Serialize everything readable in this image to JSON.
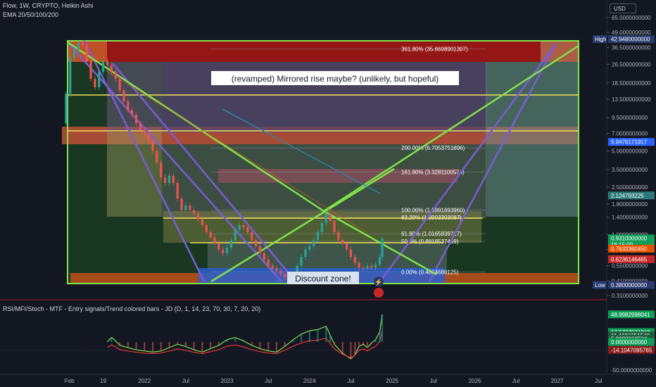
{
  "header": {
    "symbol_line": "Flow, 1W, CRYPTO, Heikin Ashi",
    "ema_line": "EMA 20/50/100/200",
    "currency": "USD"
  },
  "indicator_title": "RSI/MFI/Stoch - MTF - Entry signals/Trend colored bars - JD (D, 1, 14, 23, 70, 30, 7, 20, 20)",
  "annotations": {
    "mirror_text": "(revamped) Mirrored rise maybe? (unlikely, but hopeful)",
    "discount_text": "Discount zone!"
  },
  "fib_levels": [
    {
      "text": "361.80% (35.6698901307)",
      "price": 35.67
    },
    {
      "text": "200.00% (6.7053751896)",
      "price": 5.3
    },
    {
      "text": "161.80% (3.3281100574)",
      "price": 3.33
    },
    {
      "text": "100.00% (1.5991693960)",
      "price": 1.6
    },
    {
      "text": "83.20% (1.3903303087)",
      "price": 1.39
    },
    {
      "text": "61.80% (1.0165839717)",
      "price": 1.017
    },
    {
      "text": "50.0% (0.8818537459)",
      "price": 0.88
    },
    {
      "text": "0.00% (0.4884688125)",
      "price": 0.488
    }
  ],
  "chart_data": [
    {
      "type": "line",
      "title": "Flow, 1W, CRYPTO, Heikin Ashi",
      "y_scale": "log",
      "ylim": [
        0.31,
        65.0
      ],
      "y_ticks": [
        {
          "label": "65.0000000000",
          "value": 65.0
        },
        {
          "label": "49.0000000000",
          "value": 49.0
        },
        {
          "label": "36.5000000000",
          "value": 36.5
        },
        {
          "label": "26.5000000000",
          "value": 26.5
        },
        {
          "label": "18.5000000000",
          "value": 18.5
        },
        {
          "label": "13.5000000000",
          "value": 13.5
        },
        {
          "label": "9.5000000000",
          "value": 9.5
        },
        {
          "label": "7.0000000000",
          "value": 7.0
        },
        {
          "label": "5.0000000000",
          "value": 5.0
        },
        {
          "label": "3.5000000000",
          "value": 3.5
        },
        {
          "label": "2.5000000000",
          "value": 2.5
        },
        {
          "label": "1.8000000000",
          "value": 1.8
        },
        {
          "label": "1.4000000000",
          "value": 1.4
        },
        {
          "label": "1.0000000000",
          "value": 1.0
        },
        {
          "label": "0.7500000000",
          "value": 0.75
        },
        {
          "label": "0.5500000000",
          "value": 0.55
        },
        {
          "label": "0.4100000000",
          "value": 0.41
        },
        {
          "label": "0.3100000000",
          "value": 0.31
        }
      ],
      "price_labels": [
        {
          "text": "42.9480000000",
          "value": 42.948,
          "tag": "High",
          "color": "#2a3a6e"
        },
        {
          "text": "5.9476171917",
          "value": 5.9476,
          "color": "#2962ff"
        },
        {
          "text": "2.124793225",
          "value": 2.1248,
          "color": "#2b7a78"
        },
        {
          "text": "0.9310000000",
          "value": 0.931,
          "sub": "16:15:09",
          "color": "#0f9d58"
        },
        {
          "text": "0.7633360450",
          "value": 0.7633,
          "color": "#e65100"
        },
        {
          "text": "0.6236146465",
          "value": 0.6236,
          "color": "#c62828"
        },
        {
          "text": "0.3800000000",
          "value": 0.38,
          "tag": "Low",
          "color": "#2a3a6e"
        }
      ],
      "x_ticks": [
        "Feb",
        "19",
        "2022",
        "Jul",
        "2023",
        "Jul",
        "2024",
        "Jul",
        "2025",
        "Jul",
        "2026",
        "Jul",
        "2027",
        "Jul"
      ],
      "x_tick_times": [
        2021.09,
        2021.5,
        2022.0,
        2022.5,
        2023.0,
        2023.5,
        2024.0,
        2024.5,
        2025.0,
        2025.5,
        2026.0,
        2026.5,
        2027.0,
        2027.5
      ],
      "xlim": [
        2021.0,
        2027.6
      ],
      "series": [
        {
          "style": "heikin-ashi candles",
          "points": [
            [
              2021.0,
              8.5
            ],
            [
              2021.05,
              15
            ],
            [
              2021.1,
              30
            ],
            [
              2021.15,
              35
            ],
            [
              2021.2,
              40
            ],
            [
              2021.25,
              38
            ],
            [
              2021.3,
              28
            ],
            [
              2021.35,
              20
            ],
            [
              2021.4,
              17
            ],
            [
              2021.45,
              23
            ],
            [
              2021.5,
              28
            ],
            [
              2021.55,
              26
            ],
            [
              2021.6,
              23
            ],
            [
              2021.65,
              20
            ],
            [
              2021.7,
              16
            ],
            [
              2021.75,
              13
            ],
            [
              2021.8,
              11
            ],
            [
              2021.85,
              10
            ],
            [
              2021.9,
              8.5
            ],
            [
              2021.95,
              7.5
            ],
            [
              2022.0,
              6.8
            ],
            [
              2022.05,
              6.0
            ],
            [
              2022.1,
              5.0
            ],
            [
              2022.15,
              4.0
            ],
            [
              2022.2,
              3.0
            ],
            [
              2022.25,
              2.7
            ],
            [
              2022.3,
              3.1
            ],
            [
              2022.35,
              2.7
            ],
            [
              2022.4,
              2.0
            ],
            [
              2022.45,
              1.6
            ],
            [
              2022.5,
              1.75
            ],
            [
              2022.55,
              1.6
            ],
            [
              2022.6,
              1.5
            ],
            [
              2022.65,
              1.35
            ],
            [
              2022.7,
              1.2
            ],
            [
              2022.75,
              1.05
            ],
            [
              2022.8,
              0.95
            ],
            [
              2022.85,
              0.85
            ],
            [
              2022.9,
              0.75
            ],
            [
              2022.95,
              0.7
            ],
            [
              2023.0,
              0.78
            ],
            [
              2023.05,
              0.9
            ],
            [
              2023.1,
              1.1
            ],
            [
              2023.15,
              1.2
            ],
            [
              2023.2,
              1.15
            ],
            [
              2023.25,
              1.05
            ],
            [
              2023.3,
              0.9
            ],
            [
              2023.35,
              0.8
            ],
            [
              2023.4,
              0.7
            ],
            [
              2023.45,
              0.62
            ],
            [
              2023.5,
              0.55
            ],
            [
              2023.55,
              0.52
            ],
            [
              2023.6,
              0.5
            ],
            [
              2023.65,
              0.47
            ],
            [
              2023.7,
              0.44
            ],
            [
              2023.75,
              0.42
            ],
            [
              2023.8,
              0.45
            ],
            [
              2023.85,
              0.55
            ],
            [
              2023.9,
              0.65
            ],
            [
              2023.95,
              0.75
            ],
            [
              2024.0,
              0.8
            ],
            [
              2024.05,
              0.9
            ],
            [
              2024.1,
              1.05
            ],
            [
              2024.15,
              1.25
            ],
            [
              2024.2,
              1.5
            ],
            [
              2024.25,
              1.3
            ],
            [
              2024.3,
              1.05
            ],
            [
              2024.35,
              0.9
            ],
            [
              2024.4,
              0.85
            ],
            [
              2024.45,
              0.75
            ],
            [
              2024.5,
              0.65
            ],
            [
              2024.55,
              0.58
            ],
            [
              2024.6,
              0.53
            ],
            [
              2024.65,
              0.52
            ],
            [
              2024.7,
              0.55
            ],
            [
              2024.75,
              0.53
            ],
            [
              2024.8,
              0.56
            ],
            [
              2024.85,
              0.65
            ],
            [
              2024.88,
              0.93
            ]
          ]
        }
      ]
    },
    {
      "type": "line",
      "title": "RSI/MFI/Stoch - MTF - Entry signals/Trend colored bars - JD (D, 1, 14, 23, 70, 30, 7, 20, 20)",
      "ylim": [
        -50,
        60
      ],
      "y_ticks": [
        {
          "label": "48.9982998041",
          "value": 48.998,
          "color": "#0f9d58"
        },
        {
          "label": "17.6398794301",
          "value": 17.64,
          "color": "#1e5e3a"
        },
        {
          "label": "17.5737031818",
          "value": 17.57,
          "color": "#0f9d58"
        },
        {
          "label": "11.4626351548",
          "value": 11.46,
          "color": "#1e5e3a"
        },
        {
          "label": "5.8888268534",
          "value": 5.889,
          "color": "#1e5e3a"
        },
        {
          "label": "0.0000000000",
          "value": 0.0,
          "color": "#0f9d58"
        },
        {
          "label": "-14.1047095765",
          "value": -14.105,
          "color": "#8a1c1c"
        },
        {
          "label": "-50.0000000000",
          "value": -50.0
        }
      ],
      "series": [
        {
          "name": "",
          "values": [
            [
              2021.55,
              0
            ],
            [
              2021.6,
              8
            ],
            [
              2021.65,
              2
            ],
            [
              2021.7,
              -6
            ],
            [
              2021.8,
              -10
            ],
            [
              2021.9,
              -14
            ],
            [
              2022.0,
              -16
            ],
            [
              2022.1,
              -18
            ],
            [
              2022.2,
              -16
            ],
            [
              2022.3,
              -10
            ],
            [
              2022.4,
              -4
            ],
            [
              2022.5,
              -8
            ],
            [
              2022.6,
              -14
            ],
            [
              2022.7,
              -18
            ],
            [
              2022.8,
              -12
            ],
            [
              2022.9,
              -6
            ],
            [
              2023.0,
              4
            ],
            [
              2023.1,
              8
            ],
            [
              2023.2,
              2
            ],
            [
              2023.3,
              -6
            ],
            [
              2023.4,
              -12
            ],
            [
              2023.5,
              -16
            ],
            [
              2023.6,
              -18
            ],
            [
              2023.7,
              -8
            ],
            [
              2023.8,
              4
            ],
            [
              2023.9,
              14
            ],
            [
              2024.0,
              20
            ],
            [
              2024.1,
              22
            ],
            [
              2024.2,
              28
            ],
            [
              2024.25,
              12
            ],
            [
              2024.3,
              -4
            ],
            [
              2024.4,
              -20
            ],
            [
              2024.5,
              -30
            ],
            [
              2024.55,
              -22
            ],
            [
              2024.6,
              -8
            ],
            [
              2024.65,
              -4
            ],
            [
              2024.7,
              -10
            ],
            [
              2024.75,
              -2
            ],
            [
              2024.8,
              4
            ],
            [
              2024.85,
              18
            ],
            [
              2024.88,
              49
            ]
          ]
        }
      ]
    }
  ]
}
